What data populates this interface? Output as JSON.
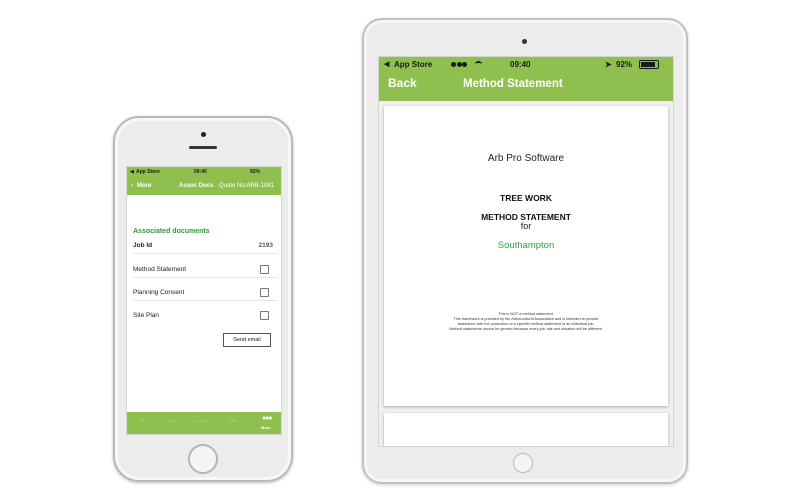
{
  "phone": {
    "status": {
      "carrier": "App Store",
      "time": "09:40",
      "battery": "92%"
    },
    "nav": {
      "back": "More",
      "title": "Assoc Docs",
      "quote": "Quote No:ARB-1081"
    },
    "section_title": "Associated documents",
    "job": {
      "label": "Job Id",
      "value": "2193"
    },
    "documents": [
      {
        "label": "Method Statement"
      },
      {
        "label": "Planning Consent"
      },
      {
        "label": "Site Plan"
      }
    ],
    "send_email": "Send email",
    "tabs": [
      "Job",
      "Work",
      "Logistic",
      "Risk",
      "More"
    ]
  },
  "tablet": {
    "status": {
      "carrier": "App Store",
      "time": "09:40",
      "battery": "92%"
    },
    "nav": {
      "back": "Back",
      "title": "Method Statement"
    },
    "doc": {
      "company": "Arb Pro Software",
      "heading1": "TREE WORK",
      "heading2": "METHOD STATEMENT",
      "for": "for",
      "place": "Southampton",
      "note_lines": [
        "This is NOT a method statement.",
        "This framework is provided by the Arboricultural Association and is intended to provide",
        "assistance with the production of a specific method statement of an individual job.",
        "Method statements cannot be generic because every job, site and situation will be different."
      ]
    }
  },
  "colors": {
    "brand_green": "#8fc04f",
    "accent_green": "#2aa53b"
  }
}
